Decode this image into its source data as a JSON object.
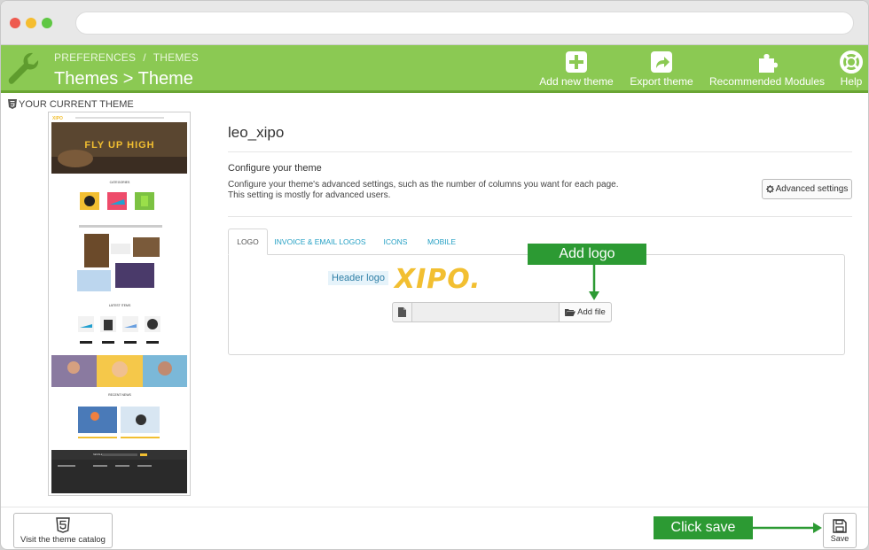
{
  "header": {
    "breadcrumb": [
      "PREFERENCES",
      "THEMES"
    ],
    "breadcrumb_separator": "/",
    "title": "Themes > Theme",
    "toolbar": {
      "add_new_theme": "Add new theme",
      "export_theme": "Export theme",
      "recommended_modules": "Recommended Modules",
      "help": "Help"
    },
    "colors": {
      "bar": "#8bc953",
      "bar_border": "#6aa534"
    }
  },
  "current_theme": {
    "label": "YOUR CURRENT THEME",
    "preview": {
      "hero_text": "FLY UP HIGH",
      "logo_text": "XIPO",
      "section_categories": "CATEGORIES",
      "section_latest_items": "LATEST ITEMS",
      "section_recent_news": "RECENT NEWS",
      "section_newsletter": "NEWSLETTER"
    }
  },
  "theme": {
    "name": "leo_xipo",
    "configure_heading": "Configure your theme",
    "configure_description": "Configure your theme's advanced settings, such as the number of columns you want for each page. This setting is mostly for advanced users.",
    "advanced_settings_label": "Advanced settings"
  },
  "tabs": [
    {
      "label": "LOGO",
      "active": true
    },
    {
      "label": "INVOICE & EMAIL LOGOS",
      "active": false
    },
    {
      "label": "ICONS",
      "active": false
    },
    {
      "label": "MOBILE",
      "active": false
    }
  ],
  "logo_tab": {
    "header_logo_label": "Header logo",
    "logo_text": "XIPO.",
    "file_input_value": "",
    "add_file_label": "Add file"
  },
  "callouts": {
    "add_logo": "Add logo",
    "click_save": "Click save",
    "color": "#2c9a33"
  },
  "footer": {
    "visit_catalog_label": "Visit the theme catalog",
    "save_label": "Save"
  }
}
